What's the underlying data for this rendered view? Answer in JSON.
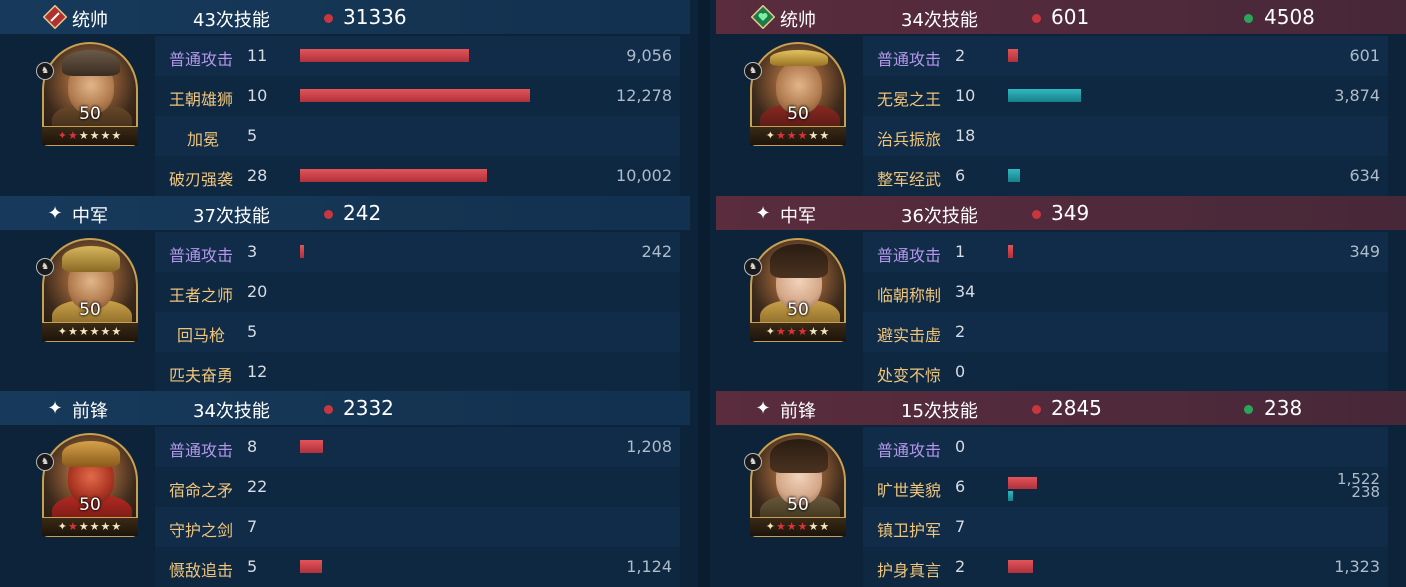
{
  "left": {
    "sections": [
      {
        "role": "统帅",
        "role_icon": "sword-shield-icon",
        "skill_count": "43次技能",
        "red_val": "31336",
        "green_val": null,
        "level": "50",
        "stars": "★★★★★",
        "skills": [
          {
            "name": "普通攻击",
            "count": "11",
            "dmg": "9,056",
            "bar": 0.33,
            "type": "atk"
          },
          {
            "name": "王朝雄狮",
            "count": "10",
            "dmg": "12,278",
            "bar": 0.45,
            "type": "skill"
          },
          {
            "name": "加冕",
            "count": "5",
            "dmg": "",
            "bar": 0,
            "type": "skill"
          },
          {
            "name": "破刃强袭",
            "count": "28",
            "dmg": "10,002",
            "bar": 0.37,
            "type": "skill"
          }
        ]
      },
      {
        "role": "中军",
        "role_icon": "sparkle-icon",
        "skill_count": "37次技能",
        "red_val": "242",
        "green_val": null,
        "level": "50",
        "stars": "★★★★★",
        "skills": [
          {
            "name": "普通攻击",
            "count": "3",
            "dmg": "242",
            "bar": 0.01,
            "type": "atk"
          },
          {
            "name": "王者之师",
            "count": "20",
            "dmg": "",
            "bar": 0,
            "type": "skill"
          },
          {
            "name": "回马枪",
            "count": "5",
            "dmg": "",
            "bar": 0,
            "type": "skill"
          },
          {
            "name": "匹夫奋勇",
            "count": "12",
            "dmg": "",
            "bar": 0,
            "type": "skill"
          }
        ]
      },
      {
        "role": "前锋",
        "role_icon": "sparkle-icon",
        "skill_count": "34次技能",
        "red_val": "2332",
        "green_val": null,
        "level": "50",
        "stars": "★★★★★",
        "skills": [
          {
            "name": "普通攻击",
            "count": "8",
            "dmg": "1,208",
            "bar": 0.05,
            "type": "atk"
          },
          {
            "name": "宿命之矛",
            "count": "22",
            "dmg": "",
            "bar": 0,
            "type": "skill"
          },
          {
            "name": "守护之剑",
            "count": "7",
            "dmg": "",
            "bar": 0,
            "type": "skill"
          },
          {
            "name": "慑敌追击",
            "count": "5",
            "dmg": "1,124",
            "bar": 0.05,
            "type": "skill"
          }
        ]
      }
    ]
  },
  "right": {
    "sections": [
      {
        "role": "统帅",
        "role_icon": "heart-shield-icon",
        "skill_count": "34次技能",
        "red_val": "601",
        "green_val": "4508",
        "level": "50",
        "stars": "★★★★★",
        "skills": [
          {
            "name": "普通攻击",
            "count": "2",
            "dmg": "601",
            "bar": 0.02,
            "type": "atk"
          },
          {
            "name": "无冕之王",
            "count": "10",
            "dmg": "3,874",
            "bar": 0.13,
            "type": "heal"
          },
          {
            "name": "治兵振旅",
            "count": "18",
            "dmg": "",
            "bar": 0,
            "type": "skill"
          },
          {
            "name": "整军经武",
            "count": "6",
            "dmg": "634",
            "bar": 0.02,
            "type": "heal"
          }
        ]
      },
      {
        "role": "中军",
        "role_icon": "sparkle-icon",
        "skill_count": "36次技能",
        "red_val": "349",
        "green_val": null,
        "level": "50",
        "stars": "★★★★★",
        "skills": [
          {
            "name": "普通攻击",
            "count": "1",
            "dmg": "349",
            "bar": 0.01,
            "type": "atk"
          },
          {
            "name": "临朝称制",
            "count": "34",
            "dmg": "",
            "bar": 0,
            "type": "skill"
          },
          {
            "name": "避实击虚",
            "count": "2",
            "dmg": "",
            "bar": 0,
            "type": "skill"
          },
          {
            "name": "处变不惊",
            "count": "0",
            "dmg": "",
            "bar": 0,
            "type": "skill"
          }
        ]
      },
      {
        "role": "前锋",
        "role_icon": "sparkle-icon",
        "skill_count": "15次技能",
        "red_val": "2845",
        "green_val": "238",
        "level": "50",
        "stars": "★★★★★",
        "skills": [
          {
            "name": "普通攻击",
            "count": "0",
            "dmg": "",
            "bar": 0,
            "type": "atk"
          },
          {
            "name": "旷世美貌",
            "count": "6",
            "dmg": "1,522",
            "dmg2": "238",
            "bar": 0.05,
            "bar2": 0.01,
            "type": "skill"
          },
          {
            "name": "镇卫护军",
            "count": "7",
            "dmg": "",
            "bar": 0,
            "type": "skill"
          },
          {
            "name": "护身真言",
            "count": "2",
            "dmg": "1,323",
            "bar": 0.05,
            "type": "skill"
          }
        ]
      }
    ]
  },
  "colors": {
    "red_dot": "#c8373d",
    "green_dot": "#2aa65a",
    "atk_label": "#b497ea",
    "skill_label": "#f0c47a"
  }
}
